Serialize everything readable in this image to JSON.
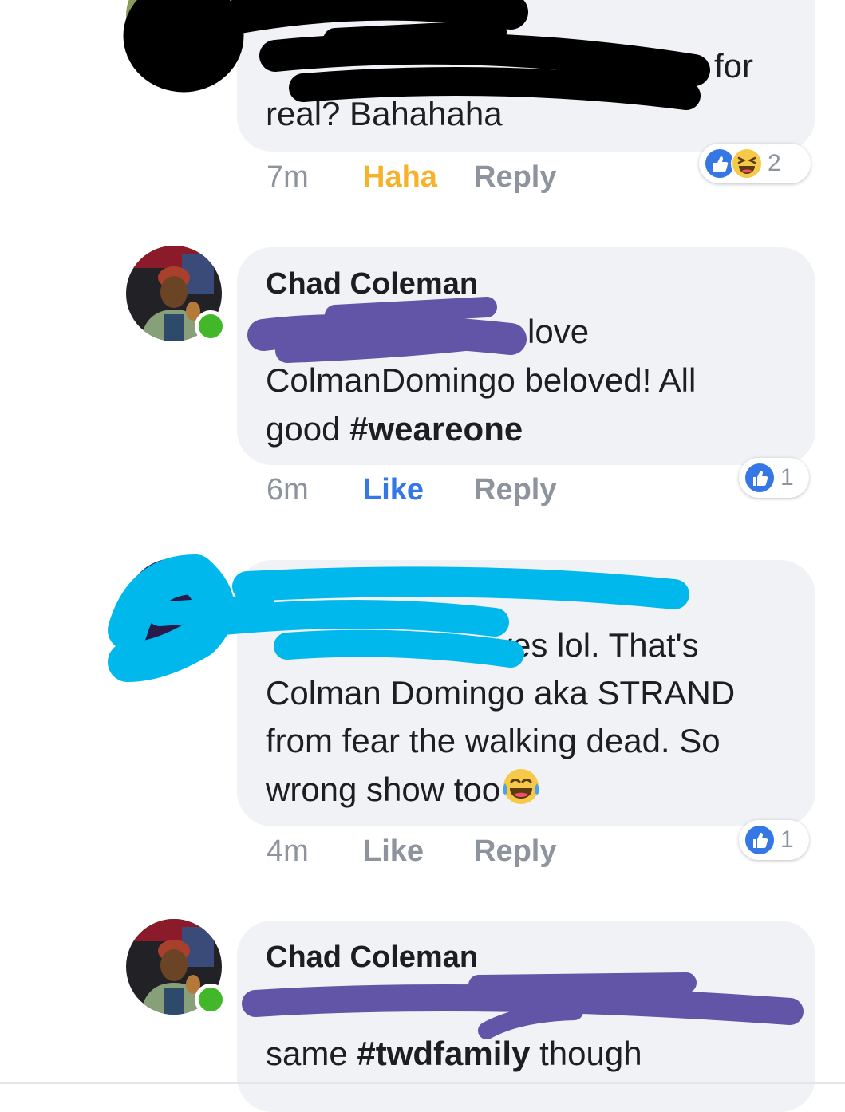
{
  "comments": [
    {
      "author": "",
      "text_fragment_1": "for",
      "text_fragment_2": "real? Bahahaha",
      "timestamp": "7m",
      "like_label": "Haha",
      "reply_label": "Reply",
      "reaction_count": "2",
      "reactions": [
        "like-icon",
        "haha-icon"
      ]
    },
    {
      "author": "Chad Coleman",
      "text_fragment_1": "love",
      "text_line_2": "ColmanDomingo beloved! All",
      "text_line_3_plain": "good ",
      "text_line_3_hashtag": "#weareone",
      "timestamp": "6m",
      "like_label": "Like",
      "reply_label": "Reply",
      "reaction_count": "1",
      "reactions": [
        "like-icon"
      ]
    },
    {
      "author": "",
      "text_fragment_1": "yes lol. That's",
      "text_line_2": "Colman Domingo aka STRAND",
      "text_line_3": "from fear the walking dead. So",
      "text_line_4": "wrong show too",
      "text_line_4_emoji": "tears-of-joy-emoji",
      "timestamp": "4m",
      "like_label": "Like",
      "reply_label": "Reply",
      "reaction_count": "1",
      "reactions": [
        "like-icon"
      ]
    },
    {
      "author": "Chad Coleman",
      "text_line_2_plain_1": "same ",
      "text_line_2_hashtag": "#twdfamily",
      "text_line_2_plain_2": " though"
    }
  ],
  "colors": {
    "bubble": "#f1f2f6",
    "like_blue": "#3578e5",
    "haha_yellow": "#f5b32c",
    "muted": "#8d949e",
    "online": "#42b72a",
    "redact_black": "#000000",
    "redact_purple": "#6254a6",
    "redact_cyan": "#00b8ec"
  }
}
